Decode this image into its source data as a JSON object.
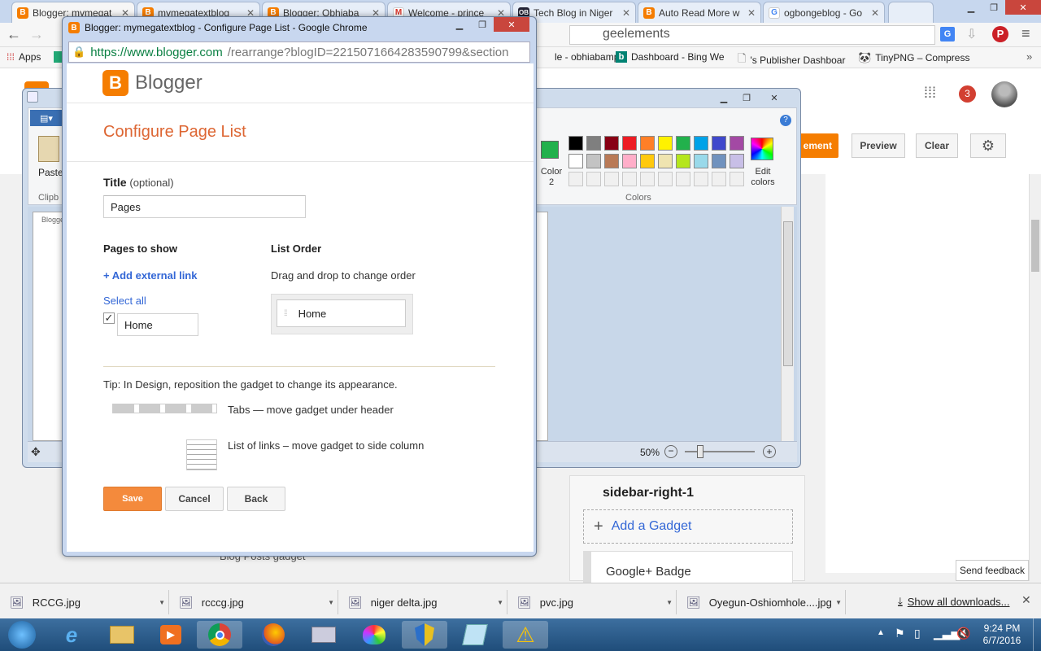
{
  "chrome": {
    "tabs": [
      {
        "label": "Blogger: mymegat",
        "icon": "blogger"
      },
      {
        "label": "mymegatextblog",
        "icon": "blogger"
      },
      {
        "label": "Blogger: Obhiaba",
        "icon": "blogger"
      },
      {
        "label": "Welcome - prince",
        "icon": "gmail"
      },
      {
        "label": "Tech Blog in Niger",
        "icon": "ob"
      },
      {
        "label": "Auto Read More w",
        "icon": "blogger"
      },
      {
        "label": "ogbongeblog - Go",
        "icon": "google"
      }
    ],
    "address_fragment": "geelements",
    "bookmarks": [
      "Apps",
      "le - obhiabamp",
      "Dashboard - Bing We",
      "'s Publisher Dashboar",
      "TinyPNG – Compress"
    ],
    "notification_count": "3"
  },
  "blogger_bg": {
    "buttons": {
      "add_element": "ement",
      "preview": "Preview",
      "clear": "Clear"
    },
    "sidebar_title": "sidebar-right-1",
    "add_gadget": "Add a Gadget",
    "gplus_badge": "Google+ Badge",
    "blog_posts_gadget": "Blog Posts gadget",
    "send_feedback": "Send feedback"
  },
  "paint": {
    "paste_label": "Paste",
    "clipboard_label": "Clipb",
    "color2_label": "Color 2",
    "edit_colors_label": "Edit colors",
    "colors_group": "Colors",
    "zoom": "50%",
    "palette_row1": [
      "#000000",
      "#7f7f7f",
      "#880015",
      "#ed1c24",
      "#ff7f27",
      "#fff200",
      "#22b14c",
      "#00a2e8",
      "#3f48cc",
      "#a349a4"
    ],
    "palette_row2": [
      "#ffffff",
      "#c3c3c3",
      "#b97a57",
      "#ffaec9",
      "#ffc90e",
      "#efe4b0",
      "#b5e61d",
      "#99d9ea",
      "#7092be",
      "#c8bfe7"
    ],
    "color1": "#22b14c"
  },
  "popup": {
    "window_title": "Blogger: mymegatextblog - Configure Page List - Google Chrome",
    "url_secure": "https://www.blogger.com",
    "url_rest": "/rearrange?blogID=2215071664283590799&section",
    "logo_text": "Blogger",
    "heading": "Configure Page List",
    "title_label": "Title",
    "title_optional": "(optional)",
    "title_value": "Pages",
    "pages_to_show": "Pages to show",
    "add_external_link": "+ Add external link",
    "select_all": "Select all",
    "page_item": "Home",
    "list_order": "List Order",
    "drag_hint": "Drag and drop to change order",
    "order_item": "Home",
    "tip": "Tip: In Design, reposition the gadget to change its appearance.",
    "tabs_hint": "Tabs — move gadget under header",
    "links_hint": "List of links – move gadget to side column",
    "save": "Save",
    "cancel": "Cancel",
    "back": "Back",
    "accent": "#f48a3c"
  },
  "downloads": {
    "items": [
      "RCCG.jpg",
      "rcccg.jpg",
      "niger delta.jpg",
      "pvc.jpg",
      "Oyegun-Oshiomhole....jpg"
    ],
    "show_all": "Show all downloads..."
  },
  "taskbar": {
    "time": "9:24 PM",
    "date": "6/7/2016"
  }
}
